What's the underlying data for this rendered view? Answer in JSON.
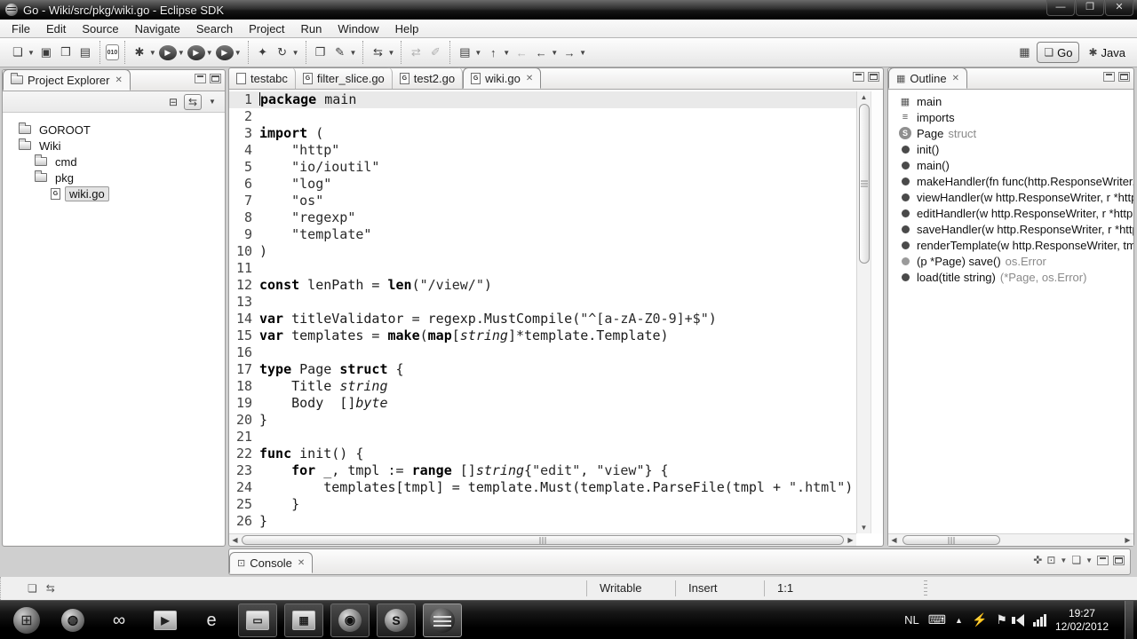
{
  "window": {
    "title": "Go - Wiki/src/pkg/wiki.go - Eclipse SDK"
  },
  "menu": {
    "items": [
      "File",
      "Edit",
      "Source",
      "Navigate",
      "Search",
      "Project",
      "Run",
      "Window",
      "Help"
    ]
  },
  "toolbar": {
    "groups": [
      {
        "icons": [
          {
            "name": "new",
            "glyph": "❏",
            "dd": true
          },
          {
            "name": "save",
            "glyph": "▣"
          },
          {
            "name": "save-all",
            "glyph": "❒"
          },
          {
            "name": "print",
            "glyph": "▤"
          }
        ]
      },
      {
        "icons": [
          {
            "name": "binary-file",
            "glyph": "010",
            "kind": "tiny-doc"
          }
        ]
      },
      {
        "icons": [
          {
            "name": "debug",
            "glyph": "✱",
            "dd": true
          },
          {
            "name": "run",
            "glyph": "▶",
            "kind": "circle",
            "dd": true
          },
          {
            "name": "run-history",
            "glyph": "▶",
            "kind": "circle",
            "dd": true
          },
          {
            "name": "run-config",
            "glyph": "▶",
            "kind": "circle",
            "dd": true
          }
        ]
      },
      {
        "icons": [
          {
            "name": "new-wizard",
            "glyph": "✦"
          },
          {
            "name": "refresh",
            "glyph": "↻",
            "dd": true
          }
        ]
      },
      {
        "icons": [
          {
            "name": "open-resource",
            "glyph": "❐"
          },
          {
            "name": "mark-occurrences",
            "glyph": "✎",
            "dd": true
          }
        ]
      },
      {
        "icons": [
          {
            "name": "toggle-editor",
            "glyph": "⇆",
            "dd": true
          }
        ]
      },
      {
        "icons": [
          {
            "name": "synchronize",
            "glyph": "⇄",
            "disabled": true
          },
          {
            "name": "format",
            "glyph": "✐",
            "disabled": true
          }
        ]
      },
      {
        "icons": [
          {
            "name": "checklist",
            "glyph": "▤",
            "dd": true
          },
          {
            "name": "go-into",
            "glyph": "↑",
            "dd": true
          },
          {
            "name": "last-edit",
            "glyph": "←",
            "disabled": true
          },
          {
            "name": "back",
            "glyph": "←",
            "dd": true
          },
          {
            "name": "forward",
            "glyph": "→",
            "dd": true
          }
        ]
      }
    ],
    "perspectives": {
      "open_icon": "▦",
      "items": [
        {
          "label": "Go",
          "active": true
        },
        {
          "label": "Java",
          "active": false
        }
      ]
    }
  },
  "project_explorer": {
    "title": "Project Explorer",
    "tree": [
      {
        "label": "GOROOT",
        "icon": "folder",
        "depth": 0
      },
      {
        "label": "Wiki",
        "icon": "folder",
        "depth": 0
      },
      {
        "label": "cmd",
        "icon": "folder",
        "depth": 1
      },
      {
        "label": "pkg",
        "icon": "folder",
        "depth": 1
      },
      {
        "label": "wiki.go",
        "icon": "go-file",
        "depth": 2,
        "selected": true
      }
    ]
  },
  "editor": {
    "tabs": [
      {
        "label": "testabc",
        "icon": "file",
        "active": false
      },
      {
        "label": "filter_slice.go",
        "icon": "go",
        "active": false
      },
      {
        "label": "test2.go",
        "icon": "go",
        "active": false
      },
      {
        "label": "wiki.go",
        "icon": "go",
        "active": true,
        "close": "✕"
      }
    ],
    "lines": [
      {
        "seg": [
          [
            "k",
            "package"
          ],
          [
            "p",
            " main"
          ]
        ]
      },
      {
        "seg": []
      },
      {
        "seg": [
          [
            "k",
            "import"
          ],
          [
            "p",
            " ("
          ]
        ]
      },
      {
        "seg": [
          [
            "p",
            "    "
          ],
          [
            "s",
            "\"http\""
          ]
        ]
      },
      {
        "seg": [
          [
            "p",
            "    "
          ],
          [
            "s",
            "\"io/ioutil\""
          ]
        ]
      },
      {
        "seg": [
          [
            "p",
            "    "
          ],
          [
            "s",
            "\"log\""
          ]
        ]
      },
      {
        "seg": [
          [
            "p",
            "    "
          ],
          [
            "s",
            "\"os\""
          ]
        ]
      },
      {
        "seg": [
          [
            "p",
            "    "
          ],
          [
            "s",
            "\"regexp\""
          ]
        ]
      },
      {
        "seg": [
          [
            "p",
            "    "
          ],
          [
            "s",
            "\"template\""
          ]
        ]
      },
      {
        "seg": [
          [
            "p",
            ")"
          ]
        ]
      },
      {
        "seg": []
      },
      {
        "seg": [
          [
            "k",
            "const"
          ],
          [
            "p",
            " lenPath = "
          ],
          [
            "k",
            "len"
          ],
          [
            "p",
            "("
          ],
          [
            "s",
            "\"/view/\""
          ],
          [
            "p",
            ")"
          ]
        ]
      },
      {
        "seg": []
      },
      {
        "seg": [
          [
            "k",
            "var"
          ],
          [
            "p",
            " titleValidator = regexp.MustCompile("
          ],
          [
            "s",
            "\"^[a-zA-Z0-9]+$\""
          ],
          [
            "p",
            ")"
          ]
        ]
      },
      {
        "seg": [
          [
            "k",
            "var"
          ],
          [
            "p",
            " templates = "
          ],
          [
            "k",
            "make"
          ],
          [
            "p",
            "("
          ],
          [
            "k",
            "map"
          ],
          [
            "p",
            "["
          ],
          [
            "i",
            "string"
          ],
          [
            "p",
            "]*template.Template)"
          ]
        ]
      },
      {
        "seg": []
      },
      {
        "seg": [
          [
            "k",
            "type"
          ],
          [
            "p",
            " Page "
          ],
          [
            "k",
            "struct"
          ],
          [
            "p",
            " {"
          ]
        ]
      },
      {
        "seg": [
          [
            "p",
            "    Title "
          ],
          [
            "i",
            "string"
          ]
        ]
      },
      {
        "seg": [
          [
            "p",
            "    Body  []"
          ],
          [
            "i",
            "byte"
          ]
        ]
      },
      {
        "seg": [
          [
            "p",
            "}"
          ]
        ]
      },
      {
        "seg": []
      },
      {
        "seg": [
          [
            "k",
            "func"
          ],
          [
            "p",
            " init() {"
          ]
        ]
      },
      {
        "seg": [
          [
            "p",
            "    "
          ],
          [
            "k",
            "for"
          ],
          [
            "p",
            " _, tmpl := "
          ],
          [
            "k",
            "range"
          ],
          [
            "p",
            " []"
          ],
          [
            "i",
            "string"
          ],
          [
            "p",
            "{"
          ],
          [
            "s",
            "\"edit\""
          ],
          [
            "p",
            ", "
          ],
          [
            "s",
            "\"view\""
          ],
          [
            "p",
            "} {"
          ]
        ]
      },
      {
        "seg": [
          [
            "p",
            "        templates[tmpl] = template.Must(template.ParseFile(tmpl + "
          ],
          [
            "s",
            "\".html\""
          ],
          [
            "p",
            ")"
          ]
        ]
      },
      {
        "seg": [
          [
            "p",
            "    }"
          ]
        ]
      },
      {
        "seg": [
          [
            "p",
            "}"
          ]
        ]
      }
    ]
  },
  "outline": {
    "title": "Outline",
    "items": [
      {
        "icon": "package",
        "label": "main"
      },
      {
        "icon": "imports",
        "label": "imports"
      },
      {
        "icon": "struct",
        "label": "Page",
        "suffix": "struct"
      },
      {
        "icon": "method",
        "label": "init()"
      },
      {
        "icon": "method",
        "label": "main()"
      },
      {
        "icon": "method",
        "label": "makeHandler(fn func(http.ResponseWriter,"
      },
      {
        "icon": "method",
        "label": "viewHandler(w http.ResponseWriter, r *http."
      },
      {
        "icon": "method",
        "label": "editHandler(w http.ResponseWriter, r *http.F"
      },
      {
        "icon": "method",
        "label": "saveHandler(w http.ResponseWriter, r *http."
      },
      {
        "icon": "method",
        "label": "renderTemplate(w http.ResponseWriter, tmp"
      },
      {
        "icon": "method-g",
        "label": "(p *Page) save()",
        "suffix": "os.Error"
      },
      {
        "icon": "method",
        "label": "load(title string)",
        "suffix": "(*Page, os.Error)"
      }
    ]
  },
  "console": {
    "title": "Console"
  },
  "status_bar": {
    "cells": [
      "Writable",
      "Insert",
      "1:1"
    ]
  },
  "taskbar": {
    "apps": [
      {
        "name": "start",
        "kind": "start",
        "glyph": "⊞"
      },
      {
        "name": "globe",
        "kind": "circle",
        "glyph": "◍"
      },
      {
        "name": "visual-studio",
        "kind": "plain",
        "glyph": "∞"
      },
      {
        "name": "media-player",
        "kind": "box",
        "glyph": "▶"
      },
      {
        "name": "internet-explorer",
        "kind": "plain",
        "glyph": "e"
      },
      {
        "name": "windows-explorer",
        "kind": "box",
        "glyph": "🗀",
        "open": true
      },
      {
        "name": "calculator",
        "kind": "box",
        "glyph": "▦",
        "open": true
      },
      {
        "name": "firefox",
        "kind": "circle",
        "glyph": "◉",
        "open": true
      },
      {
        "name": "skype",
        "kind": "circle",
        "glyph": "S",
        "open": true
      },
      {
        "name": "eclipse",
        "kind": "eclipse",
        "glyph": "",
        "open": true,
        "active": true
      }
    ],
    "tray": {
      "language": "NL",
      "time": "19:27",
      "date": "12/02/2012"
    }
  }
}
